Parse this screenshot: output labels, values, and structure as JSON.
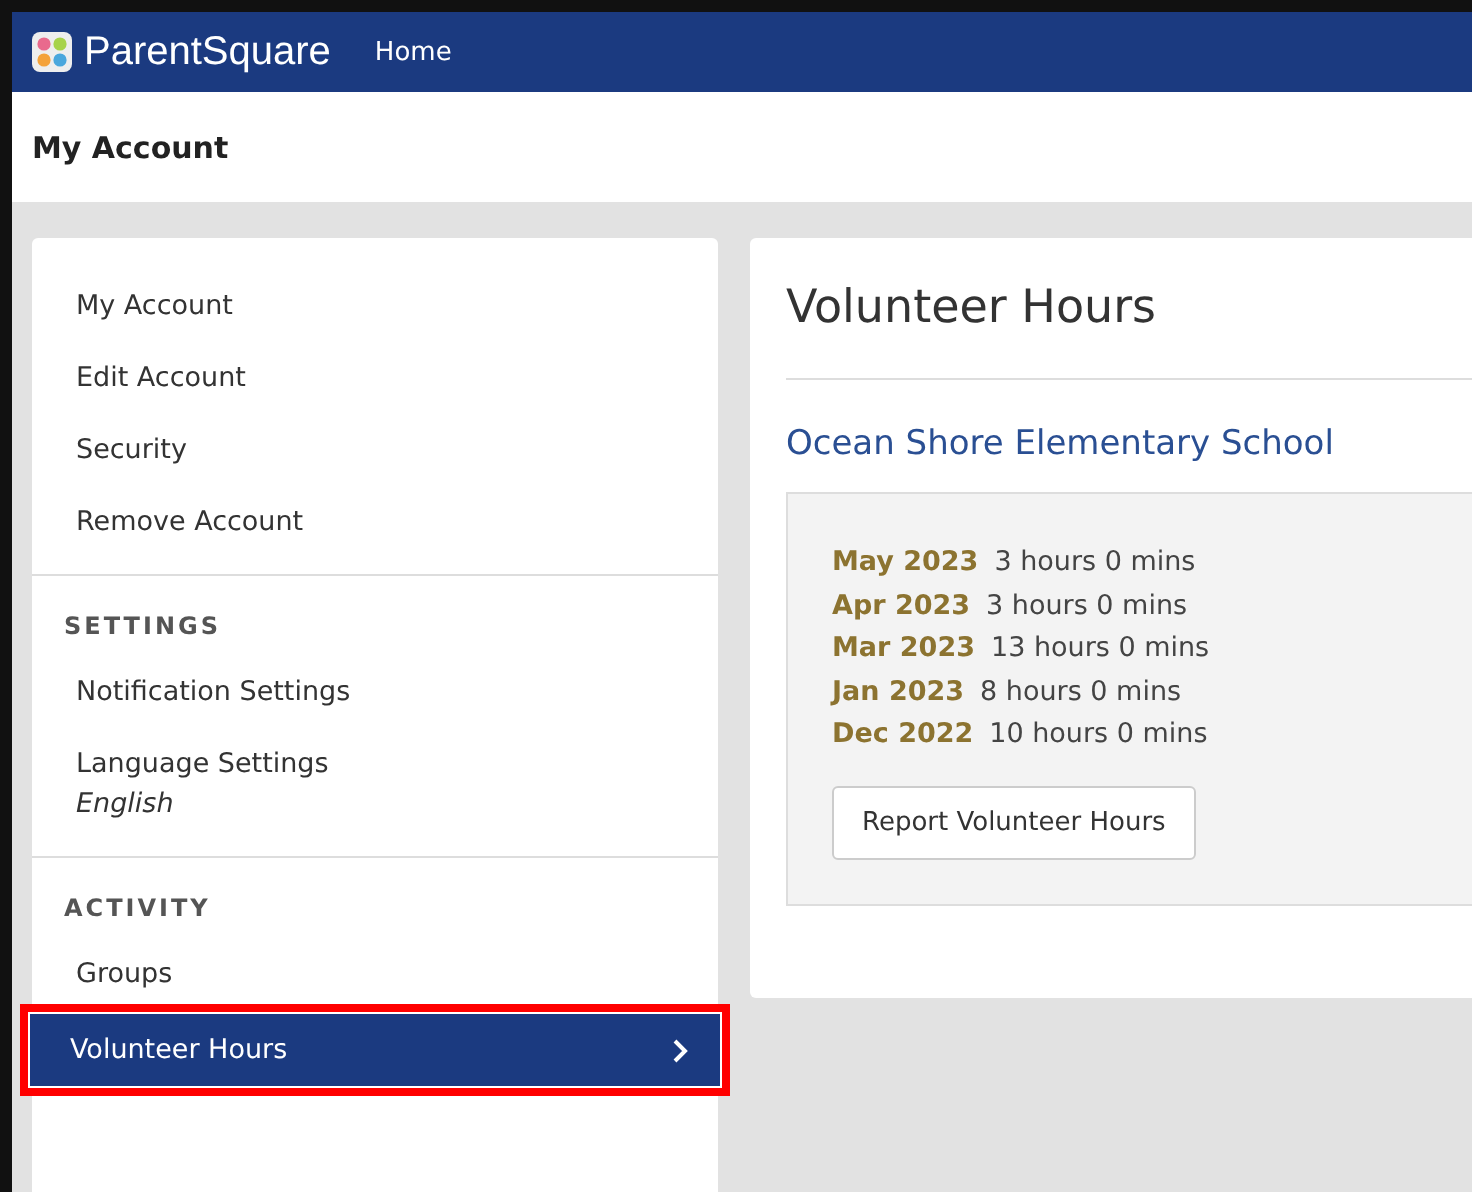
{
  "topbar": {
    "brand": "ParentSquare",
    "nav": [
      "Home"
    ]
  },
  "page_title": "My Account",
  "sidebar": {
    "sections": [
      {
        "items": [
          {
            "label": "My Account",
            "selected": false
          },
          {
            "label": "Edit Account",
            "selected": false
          },
          {
            "label": "Security",
            "selected": false
          },
          {
            "label": "Remove Account",
            "selected": false
          }
        ]
      },
      {
        "heading": "SETTINGS",
        "items": [
          {
            "label": "Notification Settings",
            "selected": false
          },
          {
            "label": "Language Settings",
            "sublabel": "English",
            "selected": false
          }
        ]
      },
      {
        "heading": "ACTIVITY",
        "items": [
          {
            "label": "Groups",
            "selected": false
          },
          {
            "label": "Volunteer Hours",
            "selected": true,
            "highlighted": true
          }
        ]
      }
    ]
  },
  "main": {
    "title": "Volunteer Hours",
    "school": "Ocean Shore Elementary School",
    "entries": [
      {
        "month": "May 2023",
        "hours": "3 hours 0 mins"
      },
      {
        "month": "Apr 2023",
        "hours": "3 hours 0 mins"
      },
      {
        "month": "Mar 2023",
        "hours": "13 hours 0 mins"
      },
      {
        "month": "Jan 2023",
        "hours": "8 hours 0 mins"
      },
      {
        "month": "Dec 2022",
        "hours": "10 hours 0 mins"
      }
    ],
    "button": "Report Volunteer Hours"
  }
}
